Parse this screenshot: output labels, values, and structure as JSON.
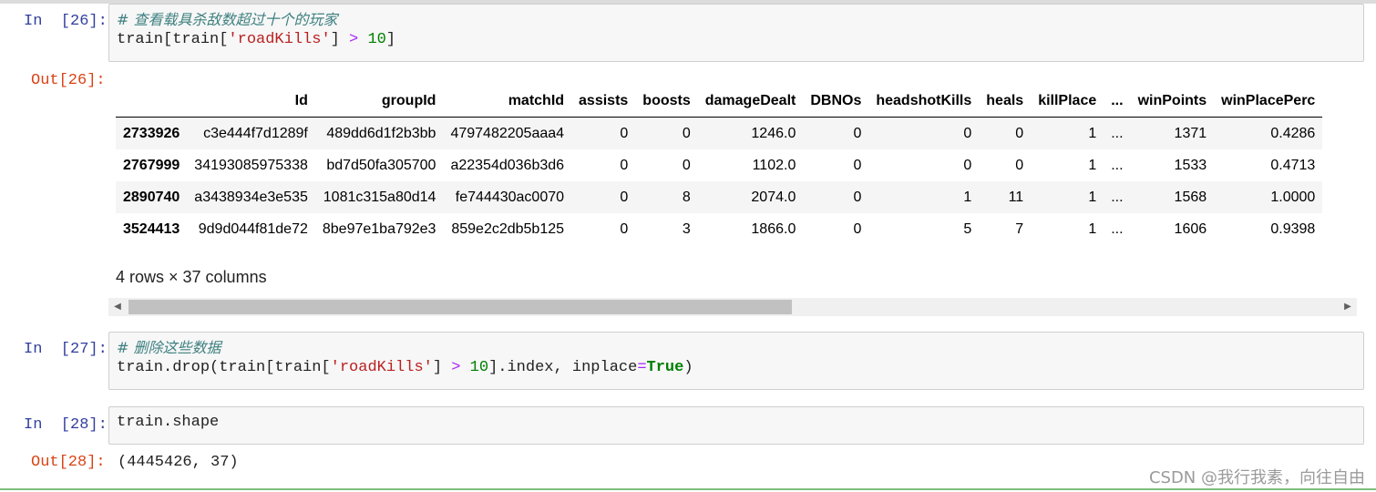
{
  "cells": [
    {
      "in_prompt": "In  [26]:",
      "comment": "# 查看载具杀敌数超过十个的玩家",
      "code": {
        "a": "train[train[",
        "str": "'roadKills'",
        "b": "] ",
        "op": ">",
        "num": " 10",
        "c": "]"
      },
      "out_prompt": "Out[26]:"
    },
    {
      "in_prompt": "In  [27]:",
      "comment": "# 删除这些数据",
      "code": {
        "a": "train.drop(train[train[",
        "str": "'roadKills'",
        "b": "] ",
        "op": ">",
        "num": " 10",
        "c": "].index, inplace",
        "eq": "=",
        "kw": "True",
        "d": ")"
      }
    },
    {
      "in_prompt": "In  [28]:",
      "code": {
        "a": "train.shape"
      },
      "out_prompt": "Out[28]:",
      "output": "(4445426, 37)"
    }
  ],
  "dataframe": {
    "columns": [
      "",
      "Id",
      "groupId",
      "matchId",
      "assists",
      "boosts",
      "damageDealt",
      "DBNOs",
      "headshotKills",
      "heals",
      "killPlace",
      "...",
      "winPoints",
      "winPlacePerc"
    ],
    "rows": [
      [
        "2733926",
        "c3e444f7d1289f",
        "489dd6d1f2b3bb",
        "4797482205aaa4",
        "0",
        "0",
        "1246.0",
        "0",
        "0",
        "0",
        "1",
        "...",
        "1371",
        "0.4286"
      ],
      [
        "2767999",
        "34193085975338",
        "bd7d50fa305700",
        "a22354d036b3d6",
        "0",
        "0",
        "1102.0",
        "0",
        "0",
        "0",
        "1",
        "...",
        "1533",
        "0.4713"
      ],
      [
        "2890740",
        "a3438934e3e535",
        "1081c315a80d14",
        "fe744430ac0070",
        "0",
        "8",
        "2074.0",
        "0",
        "1",
        "11",
        "1",
        "...",
        "1568",
        "1.0000"
      ],
      [
        "3524413",
        "9d9d044f81de72",
        "8be97e1ba792e3",
        "859e2c2db5b125",
        "0",
        "3",
        "1866.0",
        "0",
        "5",
        "7",
        "1",
        "...",
        "1606",
        "0.9398"
      ]
    ],
    "shape_text": "4 rows × 37 columns"
  },
  "scrollbar": {
    "left_arrow": "◀",
    "right_arrow": "▶"
  },
  "watermark": "CSDN @我行我素，向往自由",
  "colors": {
    "in_prompt": "#303f9f",
    "out_prompt": "#d84315",
    "comment": "#408080",
    "string": "#ba2121",
    "operator": "#aa22ff",
    "number": "#008000"
  }
}
